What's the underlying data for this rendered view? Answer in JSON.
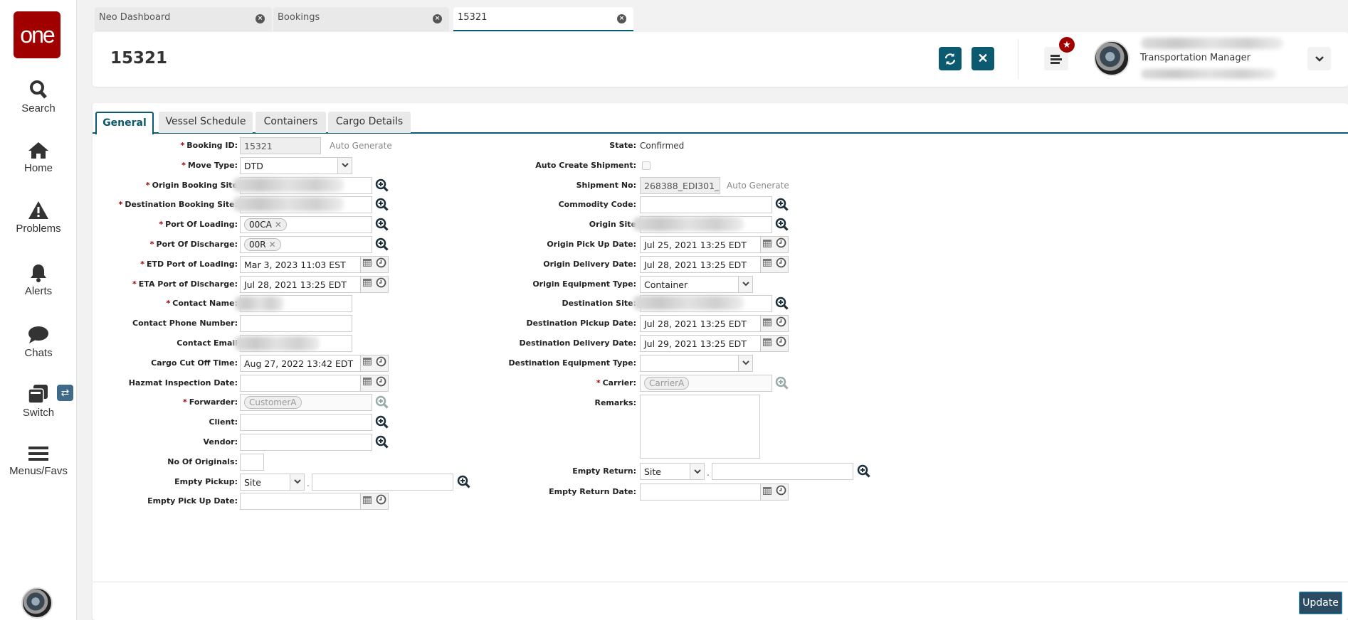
{
  "sidebar": {
    "logo": "one",
    "items": [
      {
        "label": "Search",
        "icon": "search-icon"
      },
      {
        "label": "Home",
        "icon": "home-icon"
      },
      {
        "label": "Problems",
        "icon": "warning-icon"
      },
      {
        "label": "Alerts",
        "icon": "bell-icon"
      },
      {
        "label": "Chats",
        "icon": "chat-icon"
      },
      {
        "label": "Switch",
        "icon": "windows-icon"
      },
      {
        "label": "Menus/Favs",
        "icon": "hamburger-icon"
      }
    ]
  },
  "page_tabs": [
    {
      "label": "Neo Dashboard",
      "active": false
    },
    {
      "label": "Bookings",
      "active": false
    },
    {
      "label": "15321",
      "active": true
    }
  ],
  "header": {
    "title": "15321",
    "user_role": "Transportation Manager"
  },
  "form_tabs": [
    {
      "label": "General",
      "active": true
    },
    {
      "label": "Vessel Schedule",
      "active": false
    },
    {
      "label": "Containers",
      "active": false
    },
    {
      "label": "Cargo Details",
      "active": false
    }
  ],
  "left_fields": [
    {
      "label": "Booking ID:",
      "required": true,
      "type": "readonly",
      "value": "15321",
      "hint": "Auto Generate"
    },
    {
      "label": "Move Type:",
      "required": true,
      "type": "select",
      "value": "DTD"
    },
    {
      "label": "Origin Booking Site",
      "required": true,
      "type": "lookup",
      "blurred": true
    },
    {
      "label": "Destination Booking Site:",
      "required": true,
      "type": "lookup",
      "blurred": true
    },
    {
      "label": "Port Of Loading:",
      "required": true,
      "type": "lookup",
      "chip": "00CA"
    },
    {
      "label": "Port Of Discharge:",
      "required": true,
      "type": "lookup",
      "chip": "00R"
    },
    {
      "label": "ETD Port of Loading:",
      "required": true,
      "type": "date",
      "value": "Mar 3, 2023 11:03 EST"
    },
    {
      "label": "ETA Port of Discharge:",
      "required": true,
      "type": "date",
      "value": "Jul 28, 2021 13:25 EDT"
    },
    {
      "label": "Contact Name:",
      "required": true,
      "type": "text",
      "blurred": true
    },
    {
      "label": "Contact Phone Number:",
      "required": false,
      "type": "text",
      "value": ""
    },
    {
      "label": "Contact Email",
      "required": false,
      "type": "text",
      "blurred": true
    },
    {
      "label": "Cargo Cut Off Time:",
      "required": false,
      "type": "date",
      "value": "Aug 27, 2022 13:42 EDT"
    },
    {
      "label": "Hazmat Inspection Date:",
      "required": false,
      "type": "date",
      "value": ""
    },
    {
      "label": "Forwarder:",
      "required": true,
      "type": "lookup-disabled",
      "chip": "CustomerA"
    },
    {
      "label": "Client:",
      "required": false,
      "type": "lookup",
      "value": ""
    },
    {
      "label": "Vendor:",
      "required": false,
      "type": "lookup",
      "value": ""
    },
    {
      "label": "No Of Originals:",
      "required": false,
      "type": "small",
      "value": ""
    },
    {
      "label": "Empty Pickup:",
      "required": false,
      "type": "select-lookup",
      "value": "Site",
      "separator": "."
    },
    {
      "label": "Empty Pick Up Date:",
      "required": false,
      "type": "date",
      "value": ""
    }
  ],
  "right_fields": [
    {
      "label": "State:",
      "required": false,
      "type": "static",
      "value": "Confirmed"
    },
    {
      "label": "Auto Create Shipment:",
      "required": false,
      "type": "checkbox",
      "checked": false
    },
    {
      "label": "Shipment No:",
      "required": false,
      "type": "readonly",
      "value": "268388_EDI301_'",
      "hint": "Auto Generate"
    },
    {
      "label": "Commodity Code:",
      "required": false,
      "type": "lookup",
      "value": ""
    },
    {
      "label": "Origin Site",
      "required": false,
      "type": "lookup",
      "blurred": true
    },
    {
      "label": "Origin Pick Up Date:",
      "required": false,
      "type": "date",
      "value": "Jul 25, 2021 13:25 EDT"
    },
    {
      "label": "Origin Delivery Date:",
      "required": false,
      "type": "date",
      "value": "Jul 28, 2021 13:25 EDT"
    },
    {
      "label": "Origin Equipment Type:",
      "required": false,
      "type": "select",
      "value": "Container"
    },
    {
      "label": "Destination Site:",
      "required": false,
      "type": "lookup",
      "blurred": true
    },
    {
      "label": "Destination Pickup Date:",
      "required": false,
      "type": "date",
      "value": "Jul 28, 2021 13:25 EDT"
    },
    {
      "label": "Destination Delivery Date:",
      "required": false,
      "type": "date",
      "value": "Jul 29, 2021 13:25 EDT"
    },
    {
      "label": "Destination Equipment Type:",
      "required": false,
      "type": "select",
      "value": ""
    },
    {
      "label": "Carrier:",
      "required": true,
      "type": "lookup-disabled",
      "chip": "CarrierA"
    },
    {
      "label": "Remarks:",
      "required": false,
      "type": "textarea",
      "value": ""
    },
    {
      "label": "Empty Return:",
      "required": false,
      "type": "select-lookup",
      "value": "Site",
      "separator": "."
    },
    {
      "label": "Empty Return Date:",
      "required": false,
      "type": "date",
      "value": ""
    }
  ],
  "footer": {
    "update_label": "Update"
  },
  "colors": {
    "brand": "#a00000",
    "accent": "#0b5a6f",
    "update_button": "#2d4a63",
    "required": "#a00000"
  }
}
